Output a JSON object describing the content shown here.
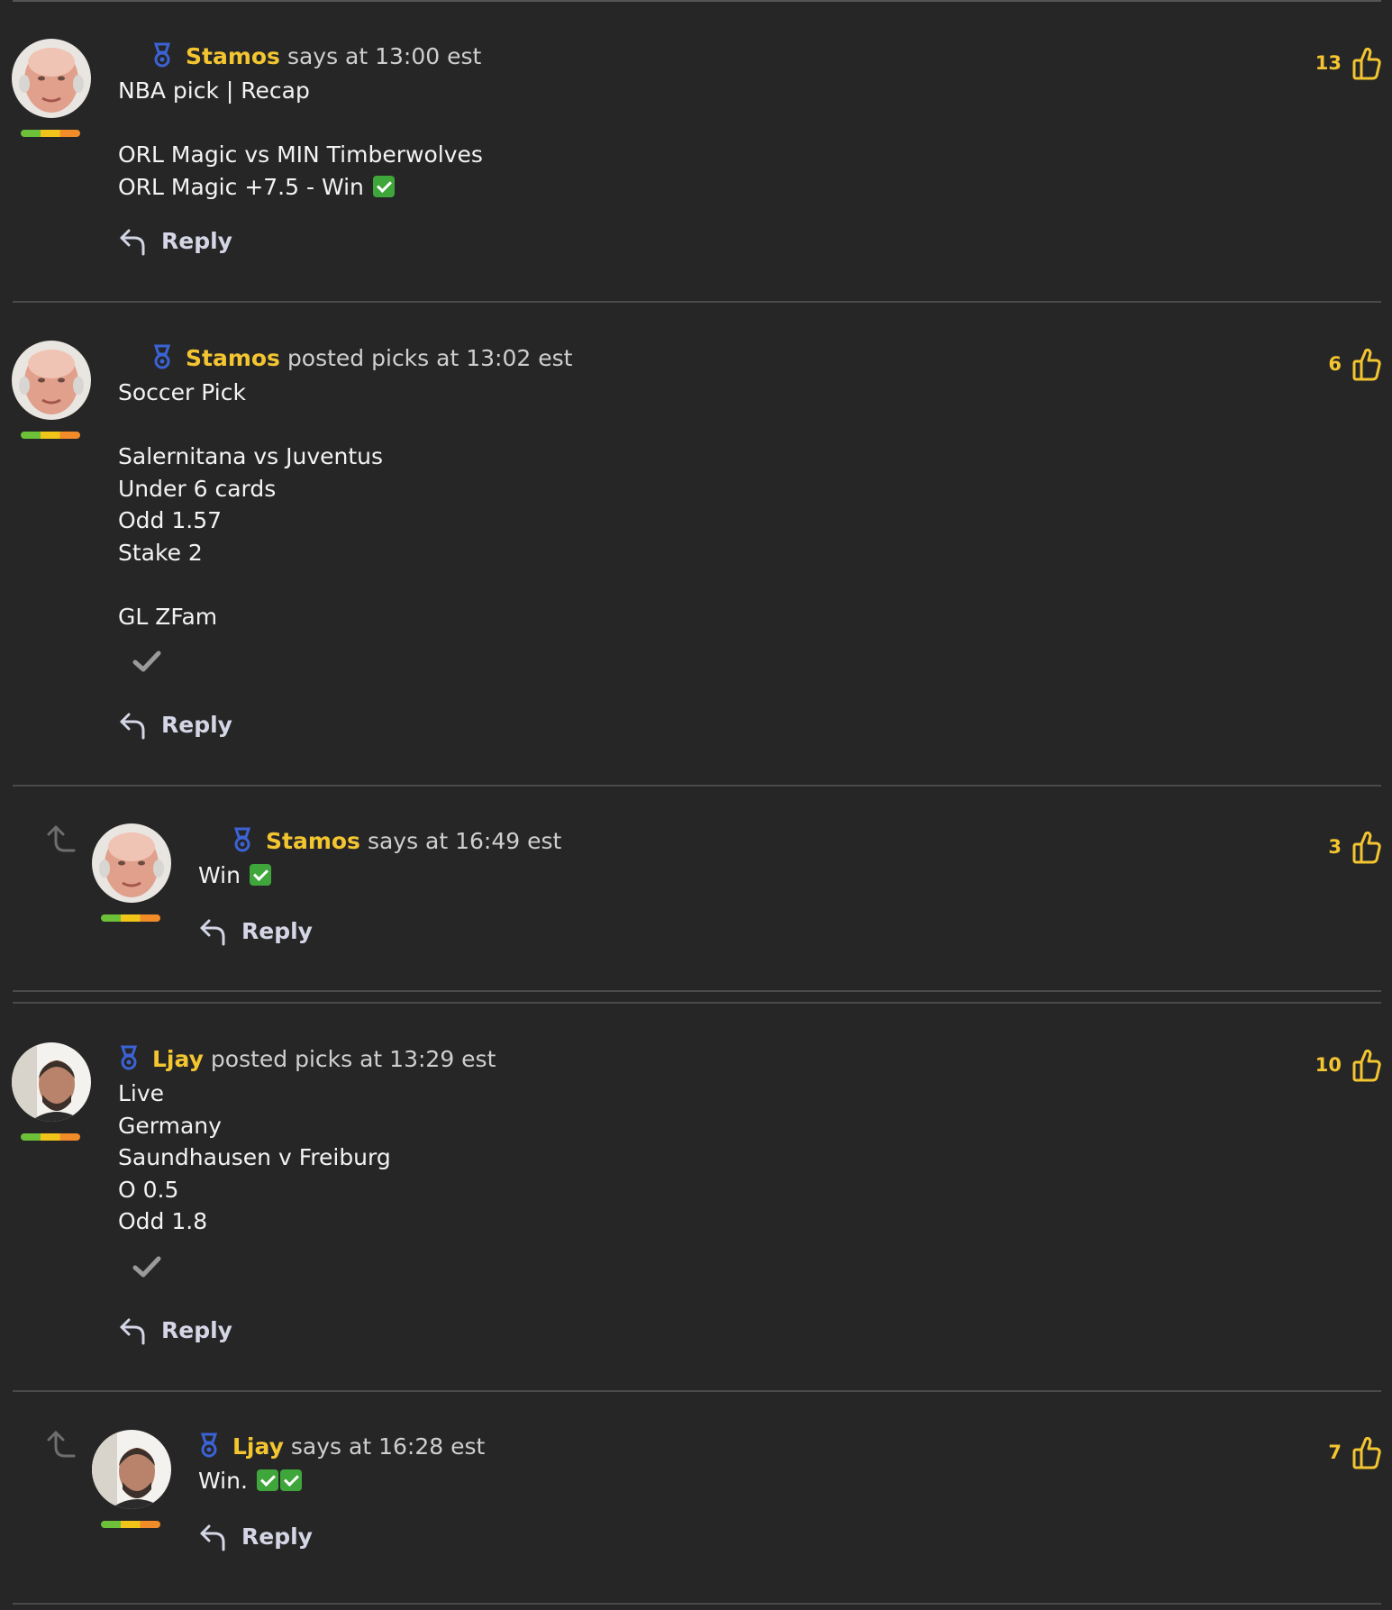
{
  "comments": [
    {
      "author": "Stamos",
      "meta": "says at 13:00 est",
      "lines": [
        "NBA pick | Recap",
        "",
        "ORL Magic vs MIN Timberwolves",
        "ORL Magic +7.5 - Win"
      ],
      "likes": "13",
      "reply_label": "Reply"
    },
    {
      "author": "Stamos",
      "meta": "posted picks at 13:02 est",
      "lines": [
        "Soccer Pick",
        "",
        "Salernitana vs Juventus",
        "Under 6 cards",
        "Odd 1.57",
        "Stake 2",
        "",
        "GL ZFam"
      ],
      "likes": "6",
      "reply_label": "Reply"
    },
    {
      "author": "Stamos",
      "meta": "says at 16:49 est",
      "lines": [
        "Win"
      ],
      "likes": "3",
      "reply_label": "Reply"
    },
    {
      "author": "Ljay",
      "meta": "posted picks at 13:29 est",
      "lines": [
        "Live",
        "Germany",
        "Saundhausen v Freiburg",
        "O 0.5",
        "Odd 1.8"
      ],
      "likes": "10",
      "reply_label": "Reply"
    },
    {
      "author": "Ljay",
      "meta": "says at 16:28 est",
      "lines": [
        "Win."
      ],
      "likes": "7",
      "reply_label": "Reply"
    }
  ],
  "colors": {
    "background": "#262626",
    "author": "#f3c531",
    "likes": "#f3c531",
    "reply": "#d4d6e6",
    "medal": "#3b63d6",
    "check_green": "#3ea63a"
  },
  "icons": [
    "medal-icon",
    "thumbs-up-icon",
    "reply-icon",
    "checkmark-icon",
    "thread-reply-icon",
    "green-check-emoji"
  ]
}
